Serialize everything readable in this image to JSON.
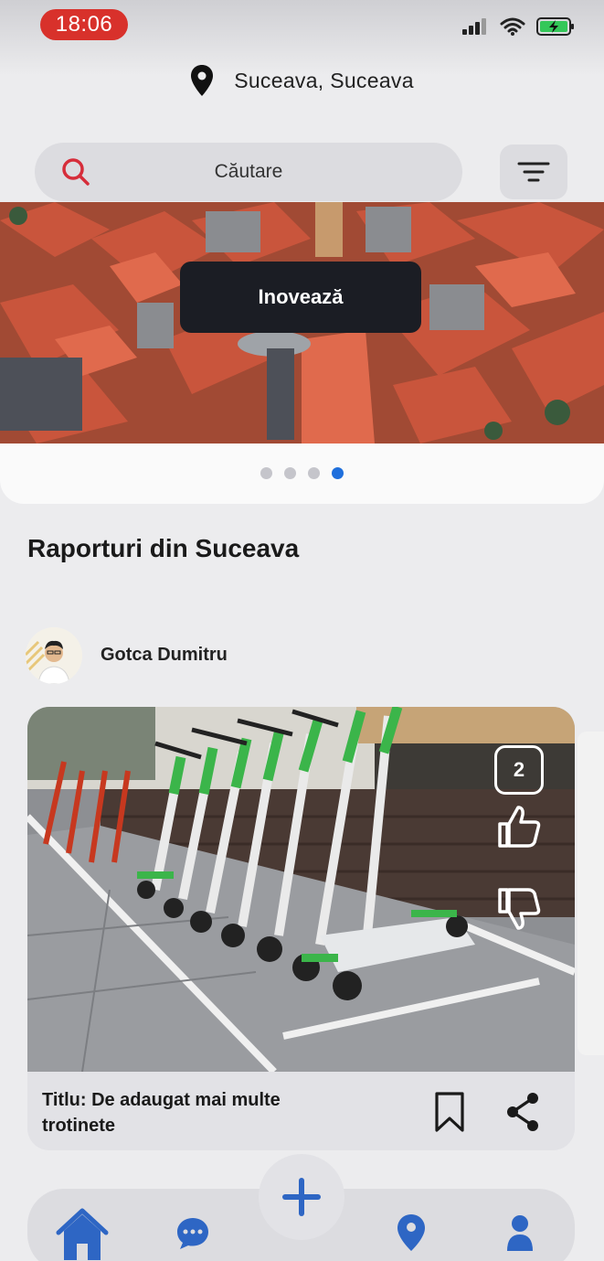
{
  "status_bar": {
    "time": "18:06",
    "time_pill_color": "#d8312b",
    "icons": [
      "signal-icon",
      "wifi-icon",
      "battery-charging-icon"
    ]
  },
  "location": {
    "icon": "map-pin-icon",
    "text": "Suceava, Suceava"
  },
  "search": {
    "icon": "search-icon",
    "placeholder": "Căutare",
    "filter_icon": "filter-icon"
  },
  "carousel": {
    "button_label": "Inovează",
    "dots_count": 4,
    "active_dot": 4,
    "accent_color": "#1f6fdc"
  },
  "section": {
    "title": "Raporturi din Suceava"
  },
  "post": {
    "author": "Gotca Dumitru",
    "vote_count": "2",
    "title": "Titlu: De adaugat mai multe trotinete",
    "actions": [
      "bookmark-icon",
      "share-icon"
    ],
    "vote_icons": [
      "thumbs-up-icon",
      "thumbs-down-icon"
    ]
  },
  "bottom_nav": {
    "items": [
      "home-icon",
      "chat-icon",
      "add-icon",
      "map-pin-icon",
      "user-icon"
    ],
    "active": "home-icon",
    "color": "#2e66c4"
  }
}
